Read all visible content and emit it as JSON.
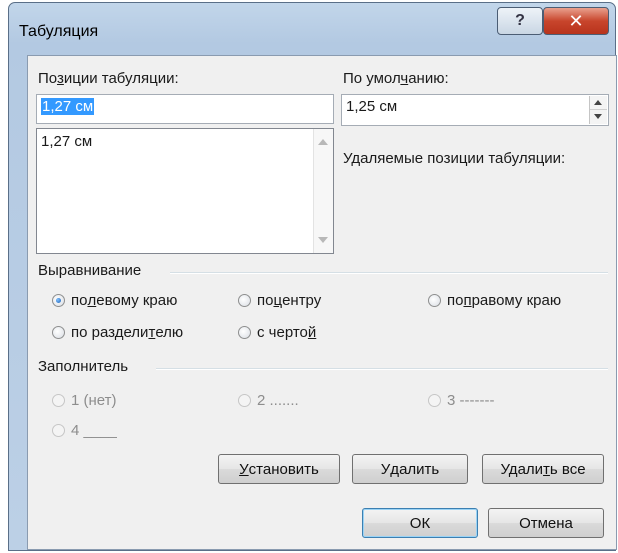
{
  "window": {
    "title": "Табуляция",
    "help_glyph": "?",
    "close_glyph": "✕"
  },
  "tab_positions": {
    "label_pre": "По",
    "label_key": "з",
    "label_post": "иции табуляции:",
    "input_value": "1,27 см",
    "list_items": [
      "1,27 см"
    ]
  },
  "default_stops": {
    "label_pre": "По умол",
    "label_key": "ч",
    "label_post": "анию:",
    "value": "1,25 см"
  },
  "clear_label": "Удаляемые позиции табуляции:",
  "alignment": {
    "group_label": "Выравнивание",
    "options": [
      {
        "pre": "по ",
        "key": "л",
        "post": "евому краю",
        "checked": true
      },
      {
        "pre": "по ",
        "key": "ц",
        "post": "ентру",
        "checked": false
      },
      {
        "pre": "по ",
        "key": "п",
        "post": "равому краю",
        "checked": false
      },
      {
        "pre": "по раздели",
        "key": "т",
        "post": "елю",
        "checked": false
      },
      {
        "pre": "с черто",
        "key": "й",
        "post": "",
        "checked": false
      }
    ]
  },
  "leader": {
    "group_label": "Заполнитель",
    "options": [
      "1 (нет)",
      "2 .......",
      "3 -------",
      "4 ____"
    ],
    "enabled": false
  },
  "buttons": {
    "set": {
      "key": "У",
      "rest": "становить"
    },
    "clear": {
      "pre": "У",
      "key": "д",
      "post": "алить"
    },
    "clear_all": {
      "pre": "Удали",
      "key": "т",
      "post": "ь все"
    },
    "ok": "ОК",
    "cancel": "Отмена"
  }
}
